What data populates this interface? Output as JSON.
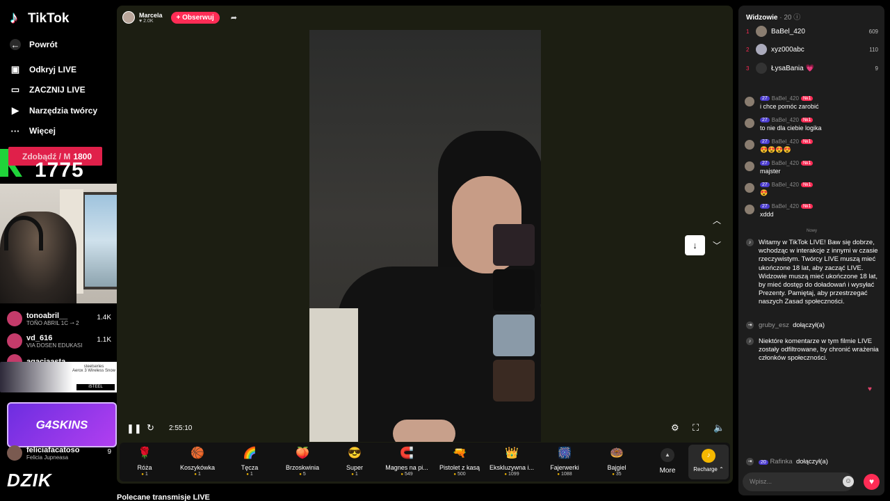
{
  "sidebar": {
    "logo_text": "TikTok",
    "back_label": "Powrót",
    "nav": [
      {
        "label": "Odkryj LIVE",
        "icon": "live-calendar-icon"
      },
      {
        "label": "ZACZNIJ LIVE",
        "icon": "camera-icon"
      },
      {
        "label": "Narzędzia twórcy",
        "icon": "creator-tools-icon"
      },
      {
        "label": "Więcej",
        "icon": "more-dots-icon"
      }
    ]
  },
  "overlay": {
    "goal_label": "Zdobądź / M",
    "goal_value": "1800",
    "counter": "1775"
  },
  "left_viewers": [
    {
      "name": "tonoabril__",
      "sub": "TOÑO ABRIL 1C ⇀ 2",
      "count": "1.4K"
    },
    {
      "name": "vd_616",
      "sub": "VIA DOSEN EDUKASI",
      "count": "1.1K"
    },
    {
      "name": "agaciaasta",
      "sub": "",
      "count": ""
    },
    {
      "name": "feliciafacatoso",
      "sub": "Felicia Jupneasa",
      "count": "9"
    }
  ],
  "ad": {
    "line1": "steelseries",
    "line2": "Aerox 3 Wireless Snow",
    "button": "iSTEEL"
  },
  "overlays_text": {
    "g4": "G4SKINS",
    "dzik": "DZIK"
  },
  "host": {
    "name": "Marcela",
    "likes": "2.0K",
    "follow_label": "+ Obserwuj"
  },
  "player": {
    "time": "2:55:10"
  },
  "gifts": [
    {
      "name": "Róża",
      "price": "1",
      "icon": "🌹"
    },
    {
      "name": "Koszykówka",
      "price": "1",
      "icon": "🏀"
    },
    {
      "name": "Tęcza",
      "price": "1",
      "icon": "🌈"
    },
    {
      "name": "Brzoskwinia",
      "price": "5",
      "icon": "🍑"
    },
    {
      "name": "Super",
      "price": "1",
      "icon": "😎"
    },
    {
      "name": "Magnes na pi...",
      "price": "549",
      "icon": "🧲"
    },
    {
      "name": "Pistolet z kasą",
      "price": "500",
      "icon": "🔫"
    },
    {
      "name": "Ekskluzywna i...",
      "price": "1099",
      "icon": "👑"
    },
    {
      "name": "Fajerwerki",
      "price": "1088",
      "icon": "🎆"
    },
    {
      "name": "Bajgiel",
      "price": "35",
      "icon": "🍩"
    }
  ],
  "more_label": "More",
  "recharge_label": "Recharge ⌃",
  "recommended_label": "Polecane transmisje LIVE",
  "chat": {
    "header": "Widzowie",
    "viewer_count": "· 20",
    "top": [
      {
        "rank": "1",
        "name": "BaBel_420",
        "score": "609"
      },
      {
        "rank": "2",
        "name": "xyz000abc",
        "score": "110"
      },
      {
        "rank": "3",
        "name": "ŁysaBania 💗",
        "score": "9"
      }
    ],
    "messages": [
      {
        "level": "27",
        "user": "BaBel_420",
        "rank": "№1",
        "text": "i chce pomóc zarobić"
      },
      {
        "level": "27",
        "user": "BaBel_420",
        "rank": "№1",
        "text": "to nie dla ciebie logika"
      },
      {
        "level": "27",
        "user": "BaBel_420",
        "rank": "№1",
        "text": "😍😍😍😍"
      },
      {
        "level": "27",
        "user": "BaBel_420",
        "rank": "№1",
        "text": "majster"
      },
      {
        "level": "27",
        "user": "BaBel_420",
        "rank": "№1",
        "text": "😍"
      },
      {
        "level": "27",
        "user": "BaBel_420",
        "rank": "№1",
        "text": "xddd"
      }
    ],
    "new_label": "Nowy",
    "welcome": "Witamy w TikTok LIVE! Baw się dobrze, wchodząc w interakcje z innymi w czasie rzeczywistym. Twórcy LIVE muszą mieć ukończone 18 lat, aby zacząć LIVE. Widzowie muszą mieć ukończone 18 lat, by mieć dostęp do doładowań i wysyłać Prezenty. Pamiętaj, aby przestrzegać naszych Zasad społeczności.",
    "join1_user": "gruby_esz",
    "join_text": "dołączył(a)",
    "filtered": "Niektóre komentarze w tym filmie LIVE zostały odfiltrowane, by chronić wrażenia członków społeczności.",
    "join2_level": "20",
    "join2_user": "Rafinka",
    "input_placeholder": "Wpisz..."
  }
}
